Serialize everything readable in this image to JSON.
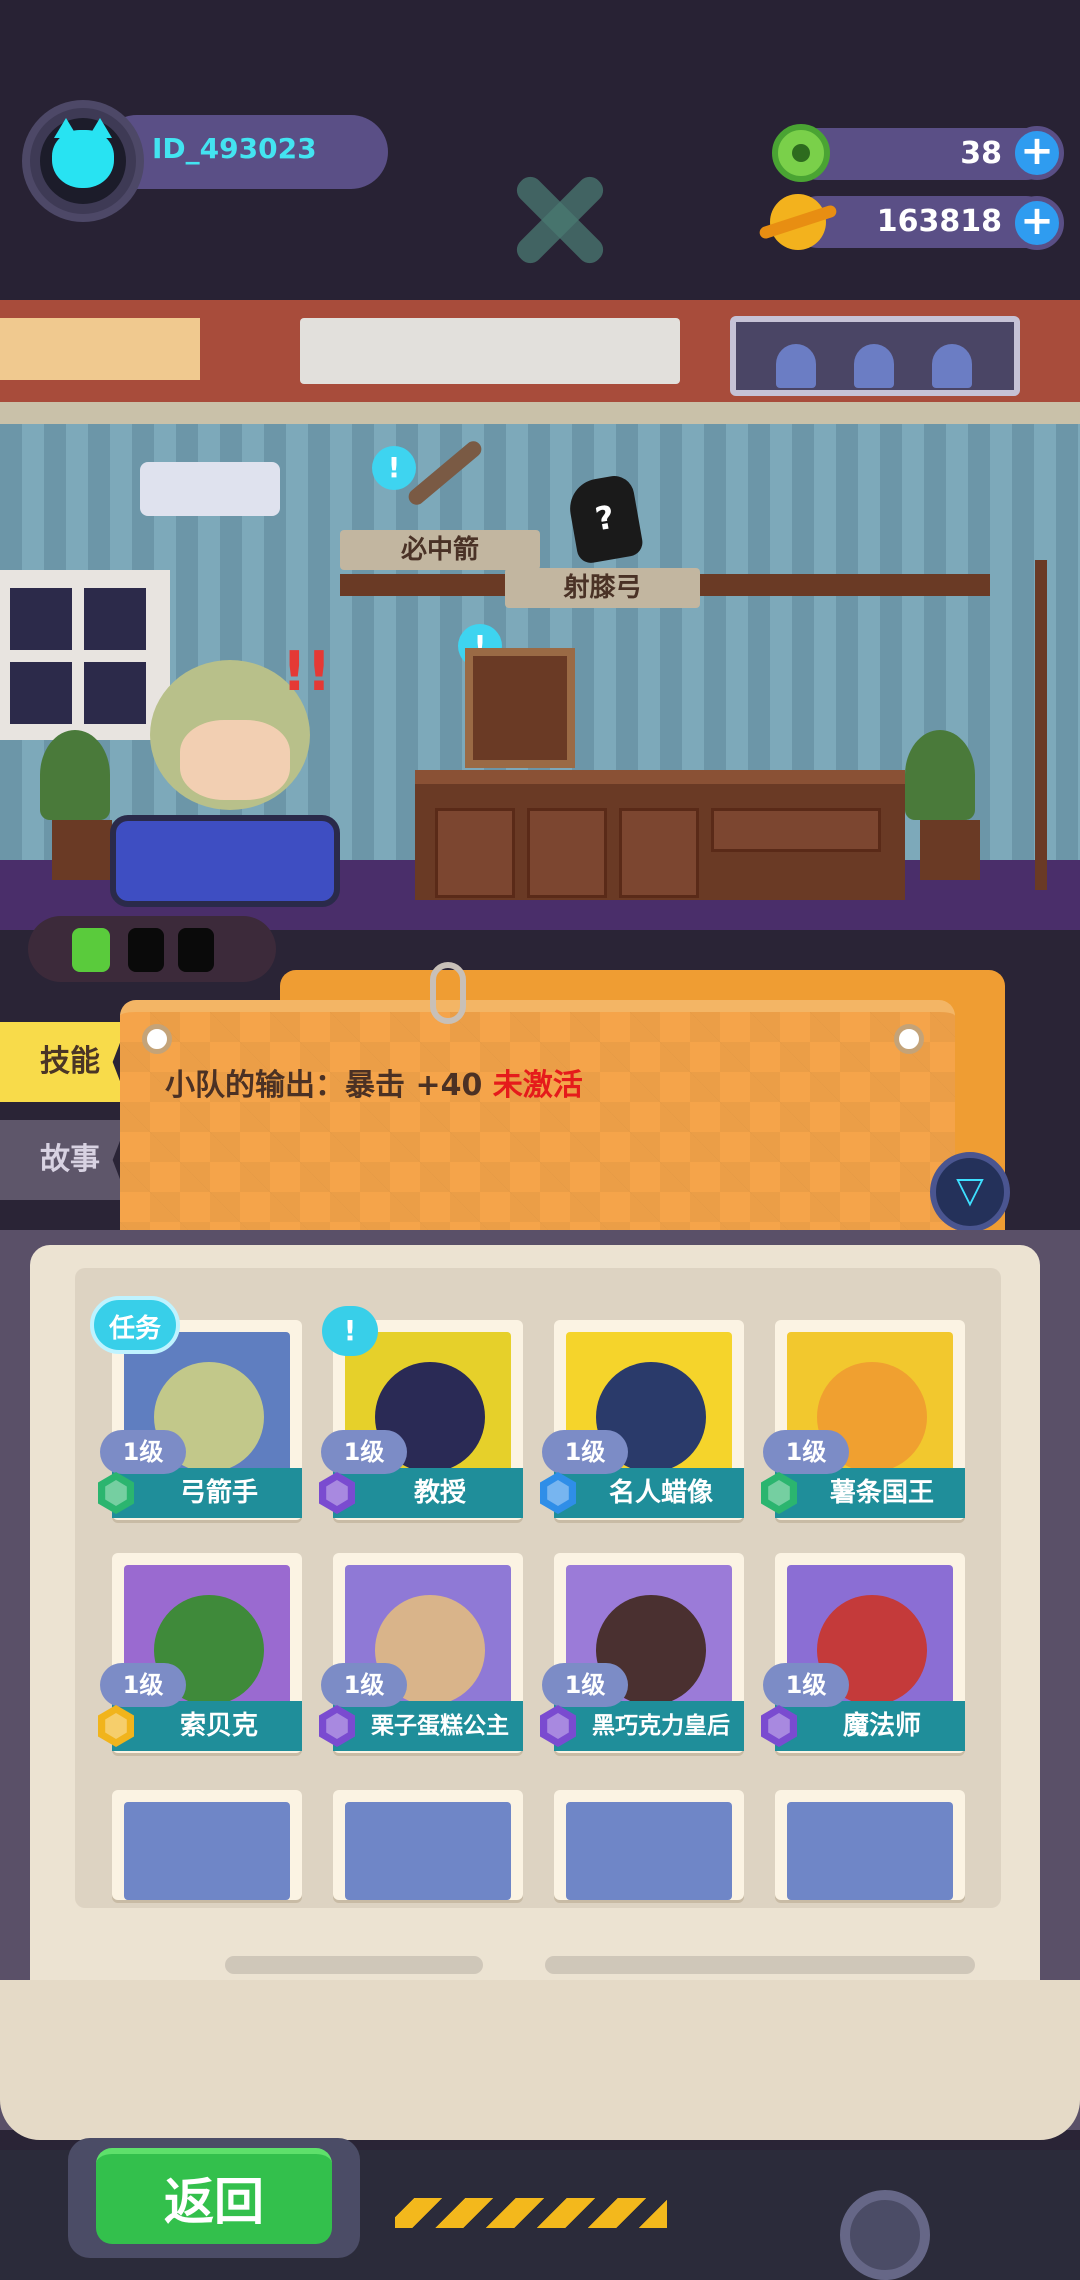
{
  "hud": {
    "player_id": "ID_493023",
    "gems": "38",
    "coins": "163818",
    "plus_symbol": "+"
  },
  "room": {
    "item_left": "必中箭",
    "item_right": "射膝弓",
    "mystery_symbol": "?",
    "alert_symbol": "!",
    "hero_alert": "!!"
  },
  "tabs": {
    "skill": "技能",
    "story": "故事"
  },
  "skill_board": {
    "description": "小队的输出：暴击 +40 ",
    "status": "未激活",
    "filter_symbol": "▽"
  },
  "badges": {
    "task": "任务",
    "notice": "!"
  },
  "characters": [
    {
      "level": "1级",
      "name": "弓箭手",
      "rarity": "green"
    },
    {
      "level": "1级",
      "name": "教授",
      "rarity": "purple"
    },
    {
      "level": "1级",
      "name": "名人蜡像",
      "rarity": "blue"
    },
    {
      "level": "1级",
      "name": "薯条国王",
      "rarity": "green"
    },
    {
      "level": "1级",
      "name": "索贝克",
      "rarity": "gold"
    },
    {
      "level": "1级",
      "name": "栗子蛋糕公主",
      "rarity": "purple"
    },
    {
      "level": "1级",
      "name": "黑巧克力皇后",
      "rarity": "purple"
    },
    {
      "level": "1级",
      "name": "魔法师",
      "rarity": "purple"
    }
  ],
  "colors": {
    "rarity_green": "#2bb56f",
    "rarity_purple": "#7a4bd0",
    "rarity_blue": "#2f8ee8",
    "rarity_gold": "#f1b41c",
    "accent_cyan": "#38cfe9",
    "status_red": "#e51b1b"
  },
  "footer": {
    "back_label": "返回"
  }
}
